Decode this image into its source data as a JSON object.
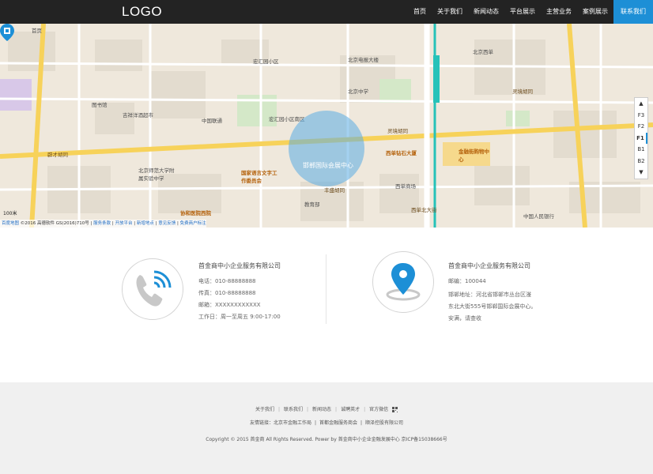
{
  "header": {
    "logo": "LOGO",
    "nav": [
      "首页",
      "关于我们",
      "新闻动态",
      "平台展示",
      "主营业务",
      "案例展示",
      "联系我们"
    ],
    "active_index": 6,
    "accent_color": "#1d8fd6"
  },
  "map": {
    "center_label": "邯郸国际会展中心",
    "floors": [
      "F3",
      "F2",
      "F1",
      "B1",
      "B2"
    ],
    "current_floor": "F1",
    "scale": "100米",
    "footer_brand": "百度地图",
    "footer_copyright": "©2016 高德软件 GS(2016)710号",
    "footer_links": [
      "服务条款",
      "开放平台",
      "新增地点",
      "意见反馈",
      "免费商户标注"
    ],
    "labels": [
      "首页",
      "辟才胡同",
      "宏汇园小区",
      "北京西单",
      "中国联通",
      "宏汇园小区南区",
      "国家语言文字工作委员会",
      "协和医院西院",
      "西单北大街",
      "教育部",
      "灵境胡同",
      "西单商场",
      "西单钻石大厦",
      "金融街购物中心",
      "北京中学",
      "丰盛胡同",
      "北京电报大楼",
      "图书馆",
      "吉祥洋酒超市",
      "北京师范大学附属实验中学",
      "中国人民银行",
      "灵境胡同"
    ]
  },
  "contact": {
    "phone": {
      "company": "首金商中小企业服务有限公司",
      "tel": "电话：010-88888888",
      "fax": "传真：010-88888888",
      "email": "邮箱：XXXXXXXXXXXX",
      "hours": "工作日：周一至周五  9:00-17:00"
    },
    "address": {
      "company": "首金商中小企业服务有限公司",
      "zip": "邮编：100044",
      "addr_line1": "邯郸地址：河北省邯郸市丛台区滏",
      "addr_line2": "东北大街555号邯郸国际会展中心。",
      "note": "安满，请查收"
    }
  },
  "footer": {
    "links": [
      "关于我们",
      "联系我们",
      "新闻动态",
      "诚聘英才",
      "官方微信"
    ],
    "friends_label": "友情链接：",
    "friends": [
      "北京市金融工作局",
      "首都金融服务商会",
      "顺泽控股有限公司"
    ],
    "copyright": "Copyright © 2015 首金商 All Rights Reserved. Power by 首金商中小企业金融发展中心  京ICP备15038666号"
  }
}
